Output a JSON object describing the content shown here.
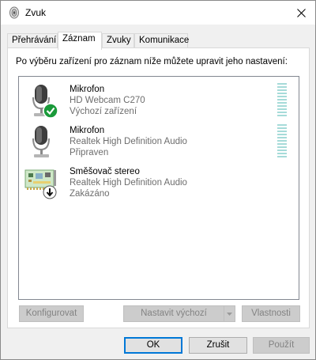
{
  "window": {
    "title": "Zvuk",
    "icon": "speaker-icon",
    "close_icon": "close-icon"
  },
  "tabs": [
    {
      "label": "Přehrávání",
      "active": false
    },
    {
      "label": "Záznam",
      "active": true
    },
    {
      "label": "Zvuky",
      "active": false
    },
    {
      "label": "Komunikace",
      "active": false
    }
  ],
  "panel": {
    "description": "Po výběru zařízení pro záznam níže můžete upravit jeho nastavení:"
  },
  "devices": [
    {
      "name": "Mikrofon",
      "detail": "HD Webcam C270",
      "status": "Výchozí zařízení",
      "icon": "microphone-icon",
      "badge": "default-check-icon",
      "meter": true
    },
    {
      "name": "Mikrofon",
      "detail": "Realtek High Definition Audio",
      "status": "Připraven",
      "icon": "microphone-icon",
      "badge": "",
      "meter": true
    },
    {
      "name": "Směšovač stereo",
      "detail": "Realtek High Definition Audio",
      "status": "Zakázáno",
      "icon": "sound-card-icon",
      "badge": "disabled-arrow-icon",
      "meter": false
    }
  ],
  "panel_buttons": {
    "configure": "Konfigurovat",
    "set_default": "Nastavit výchozí",
    "properties": "Vlastnosti"
  },
  "dialog_buttons": {
    "ok": "OK",
    "cancel": "Zrušit",
    "apply": "Použít"
  },
  "colors": {
    "accent": "#0078d7",
    "check_badge": "#1a9a3a",
    "meter": "#a6dbd9"
  }
}
